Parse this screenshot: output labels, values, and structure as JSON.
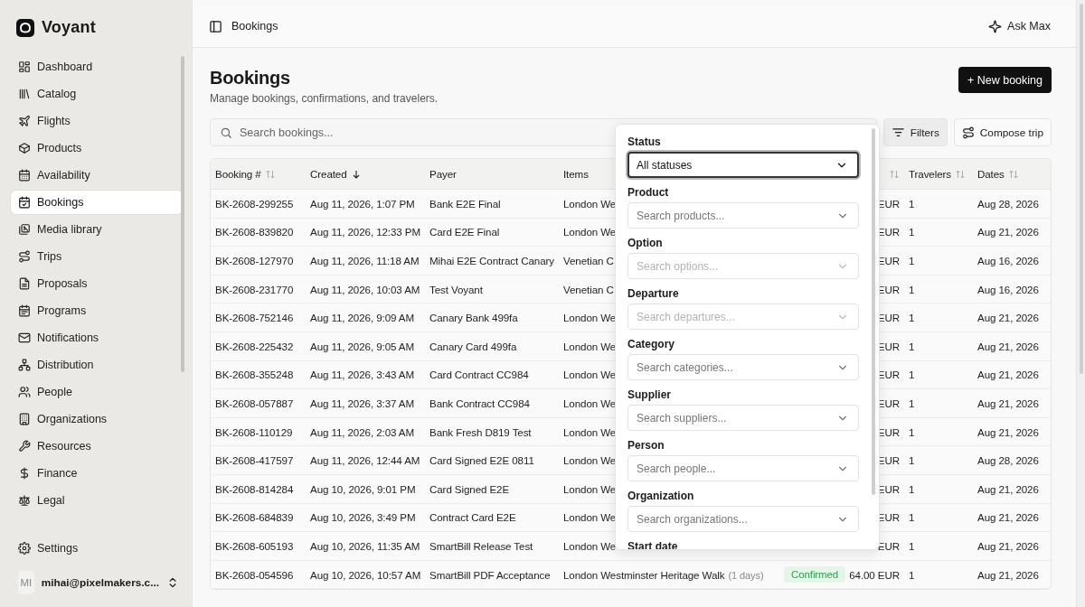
{
  "brand": {
    "name": "Voyant"
  },
  "sidebar": {
    "items": [
      {
        "label": "Dashboard",
        "selected": false
      },
      {
        "label": "Catalog",
        "selected": false
      },
      {
        "label": "Flights",
        "selected": false
      },
      {
        "label": "Products",
        "selected": false
      },
      {
        "label": "Availability",
        "selected": false
      },
      {
        "label": "Bookings",
        "selected": true
      },
      {
        "label": "Media library",
        "selected": false
      },
      {
        "label": "Trips",
        "selected": false
      },
      {
        "label": "Proposals",
        "selected": false
      },
      {
        "label": "Programs",
        "selected": false
      },
      {
        "label": "Notifications",
        "selected": false
      },
      {
        "label": "Distribution",
        "selected": false
      },
      {
        "label": "People",
        "selected": false
      },
      {
        "label": "Organizations",
        "selected": false
      },
      {
        "label": "Resources",
        "selected": false
      },
      {
        "label": "Finance",
        "selected": false
      },
      {
        "label": "Legal",
        "selected": false
      }
    ],
    "settings": "Settings",
    "user": {
      "initials": "MI",
      "email": "mihai@pixelmakers.c..."
    }
  },
  "topbar": {
    "breadcrumb": "Bookings",
    "assistant": "Ask Max"
  },
  "page": {
    "title": "Bookings",
    "subtitle": "Manage bookings, confirmations, and travelers.",
    "new_button": "+ New booking"
  },
  "toolbar": {
    "search_placeholder": "Search bookings...",
    "filters": {
      "label": "Filters",
      "active": true
    },
    "compose": "Compose trip"
  },
  "table": {
    "columns": [
      {
        "label": "Booking #",
        "sortable": true,
        "sorted": false
      },
      {
        "label": "Created",
        "sortable": true,
        "sorted": true
      },
      {
        "label": "Payer",
        "sortable": false,
        "sorted": false
      },
      {
        "label": "Items",
        "sortable": false,
        "sorted": false
      },
      {
        "sortable": true,
        "sorted": false
      },
      {
        "label": "Travelers",
        "sortable": true,
        "sorted": false
      },
      {
        "label": "Dates",
        "sortable": true,
        "sorted": false
      }
    ],
    "rows": [
      {
        "booking": "BK-2608-299255",
        "created": "Aug 11, 2026, 1:07 PM",
        "payer": "Bank E2E Final",
        "items": "London We",
        "amount": "EUR",
        "travelers": "1",
        "dates": "Aug 28, 2026"
      },
      {
        "booking": "BK-2608-839820",
        "created": "Aug 11, 2026, 12:33 PM",
        "payer": "Card E2E Final",
        "items": "London We",
        "amount": "EUR",
        "travelers": "1",
        "dates": "Aug 21, 2026"
      },
      {
        "booking": "BK-2608-127970",
        "created": "Aug 11, 2026, 11:18 AM",
        "payer": "Mihai E2E Contract Canary",
        "items": "Venetian C",
        "amount": "EUR",
        "travelers": "1",
        "dates": "Aug 16, 2026"
      },
      {
        "booking": "BK-2608-231770",
        "created": "Aug 11, 2026, 10:03 AM",
        "payer": "Test Voyant",
        "items": "Venetian C",
        "amount": "EUR",
        "travelers": "1",
        "dates": "Aug 16, 2026"
      },
      {
        "booking": "BK-2608-752146",
        "created": "Aug 11, 2026, 9:09 AM",
        "payer": "Canary Bank 499fa",
        "items": "London We",
        "amount": "EUR",
        "travelers": "1",
        "dates": "Aug 21, 2026"
      },
      {
        "booking": "BK-2608-225432",
        "created": "Aug 11, 2026, 9:05 AM",
        "payer": "Canary Card 499fa",
        "items": "London We",
        "amount": "EUR",
        "travelers": "1",
        "dates": "Aug 21, 2026"
      },
      {
        "booking": "BK-2608-355248",
        "created": "Aug 11, 2026, 3:43 AM",
        "payer": "Card Contract CC984",
        "items": "London We",
        "amount": "EUR",
        "travelers": "1",
        "dates": "Aug 21, 2026"
      },
      {
        "booking": "BK-2608-057887",
        "created": "Aug 11, 2026, 3:37 AM",
        "payer": "Bank Contract CC984",
        "items": "London We",
        "amount": "EUR",
        "travelers": "1",
        "dates": "Aug 21, 2026"
      },
      {
        "booking": "BK-2608-110129",
        "created": "Aug 11, 2026, 2:03 AM",
        "payer": "Bank Fresh D819 Test",
        "items": "London We",
        "amount": "EUR",
        "travelers": "1",
        "dates": "Aug 21, 2026"
      },
      {
        "booking": "BK-2608-417597",
        "created": "Aug 11, 2026, 12:44 AM",
        "payer": "Card Signed E2E 0811",
        "items": "London We",
        "amount": "EUR",
        "travelers": "1",
        "dates": "Aug 28, 2026"
      },
      {
        "booking": "BK-2608-814284",
        "created": "Aug 10, 2026, 9:01 PM",
        "payer": "Card Signed E2E",
        "items": "London We",
        "amount": "EUR",
        "travelers": "1",
        "dates": "Aug 21, 2026"
      },
      {
        "booking": "BK-2608-684839",
        "created": "Aug 10, 2026, 3:49 PM",
        "payer": "Contract Card E2E",
        "items": "London We",
        "amount": "EUR",
        "travelers": "1",
        "dates": "Aug 21, 2026"
      },
      {
        "booking": "BK-2608-605193",
        "created": "Aug 10, 2026, 11:35 AM",
        "payer": "SmartBill Release Test",
        "items": "London We",
        "amount": "EUR",
        "travelers": "1",
        "dates": "Aug 21, 2026"
      },
      {
        "booking": "BK-2608-054596",
        "created": "Aug 10, 2026, 10:57 AM",
        "payer": "SmartBill PDF Acceptance",
        "items": "London Westminster Heritage Walk",
        "duration": "(1 days)",
        "status": "Confirmed",
        "amount": "64.00 EUR",
        "travelers": "1",
        "dates": "Aug 21, 2026"
      }
    ]
  },
  "filter_panel": {
    "fields": [
      {
        "label": "Status",
        "value": "All statuses",
        "focused": true,
        "disabled": false
      },
      {
        "label": "Product",
        "placeholder": "Search products...",
        "focused": false,
        "disabled": false
      },
      {
        "label": "Option",
        "placeholder": "Search options...",
        "focused": false,
        "disabled": true
      },
      {
        "label": "Departure",
        "placeholder": "Search departures...",
        "focused": false,
        "disabled": true
      },
      {
        "label": "Category",
        "placeholder": "Search categories...",
        "focused": false,
        "disabled": false
      },
      {
        "label": "Supplier",
        "placeholder": "Search suppliers...",
        "focused": false,
        "disabled": false
      },
      {
        "label": "Person",
        "placeholder": "Search people...",
        "focused": false,
        "disabled": false
      },
      {
        "label": "Organization",
        "placeholder": "Search organizations...",
        "focused": false,
        "disabled": false
      }
    ],
    "next_label": "Start date"
  }
}
